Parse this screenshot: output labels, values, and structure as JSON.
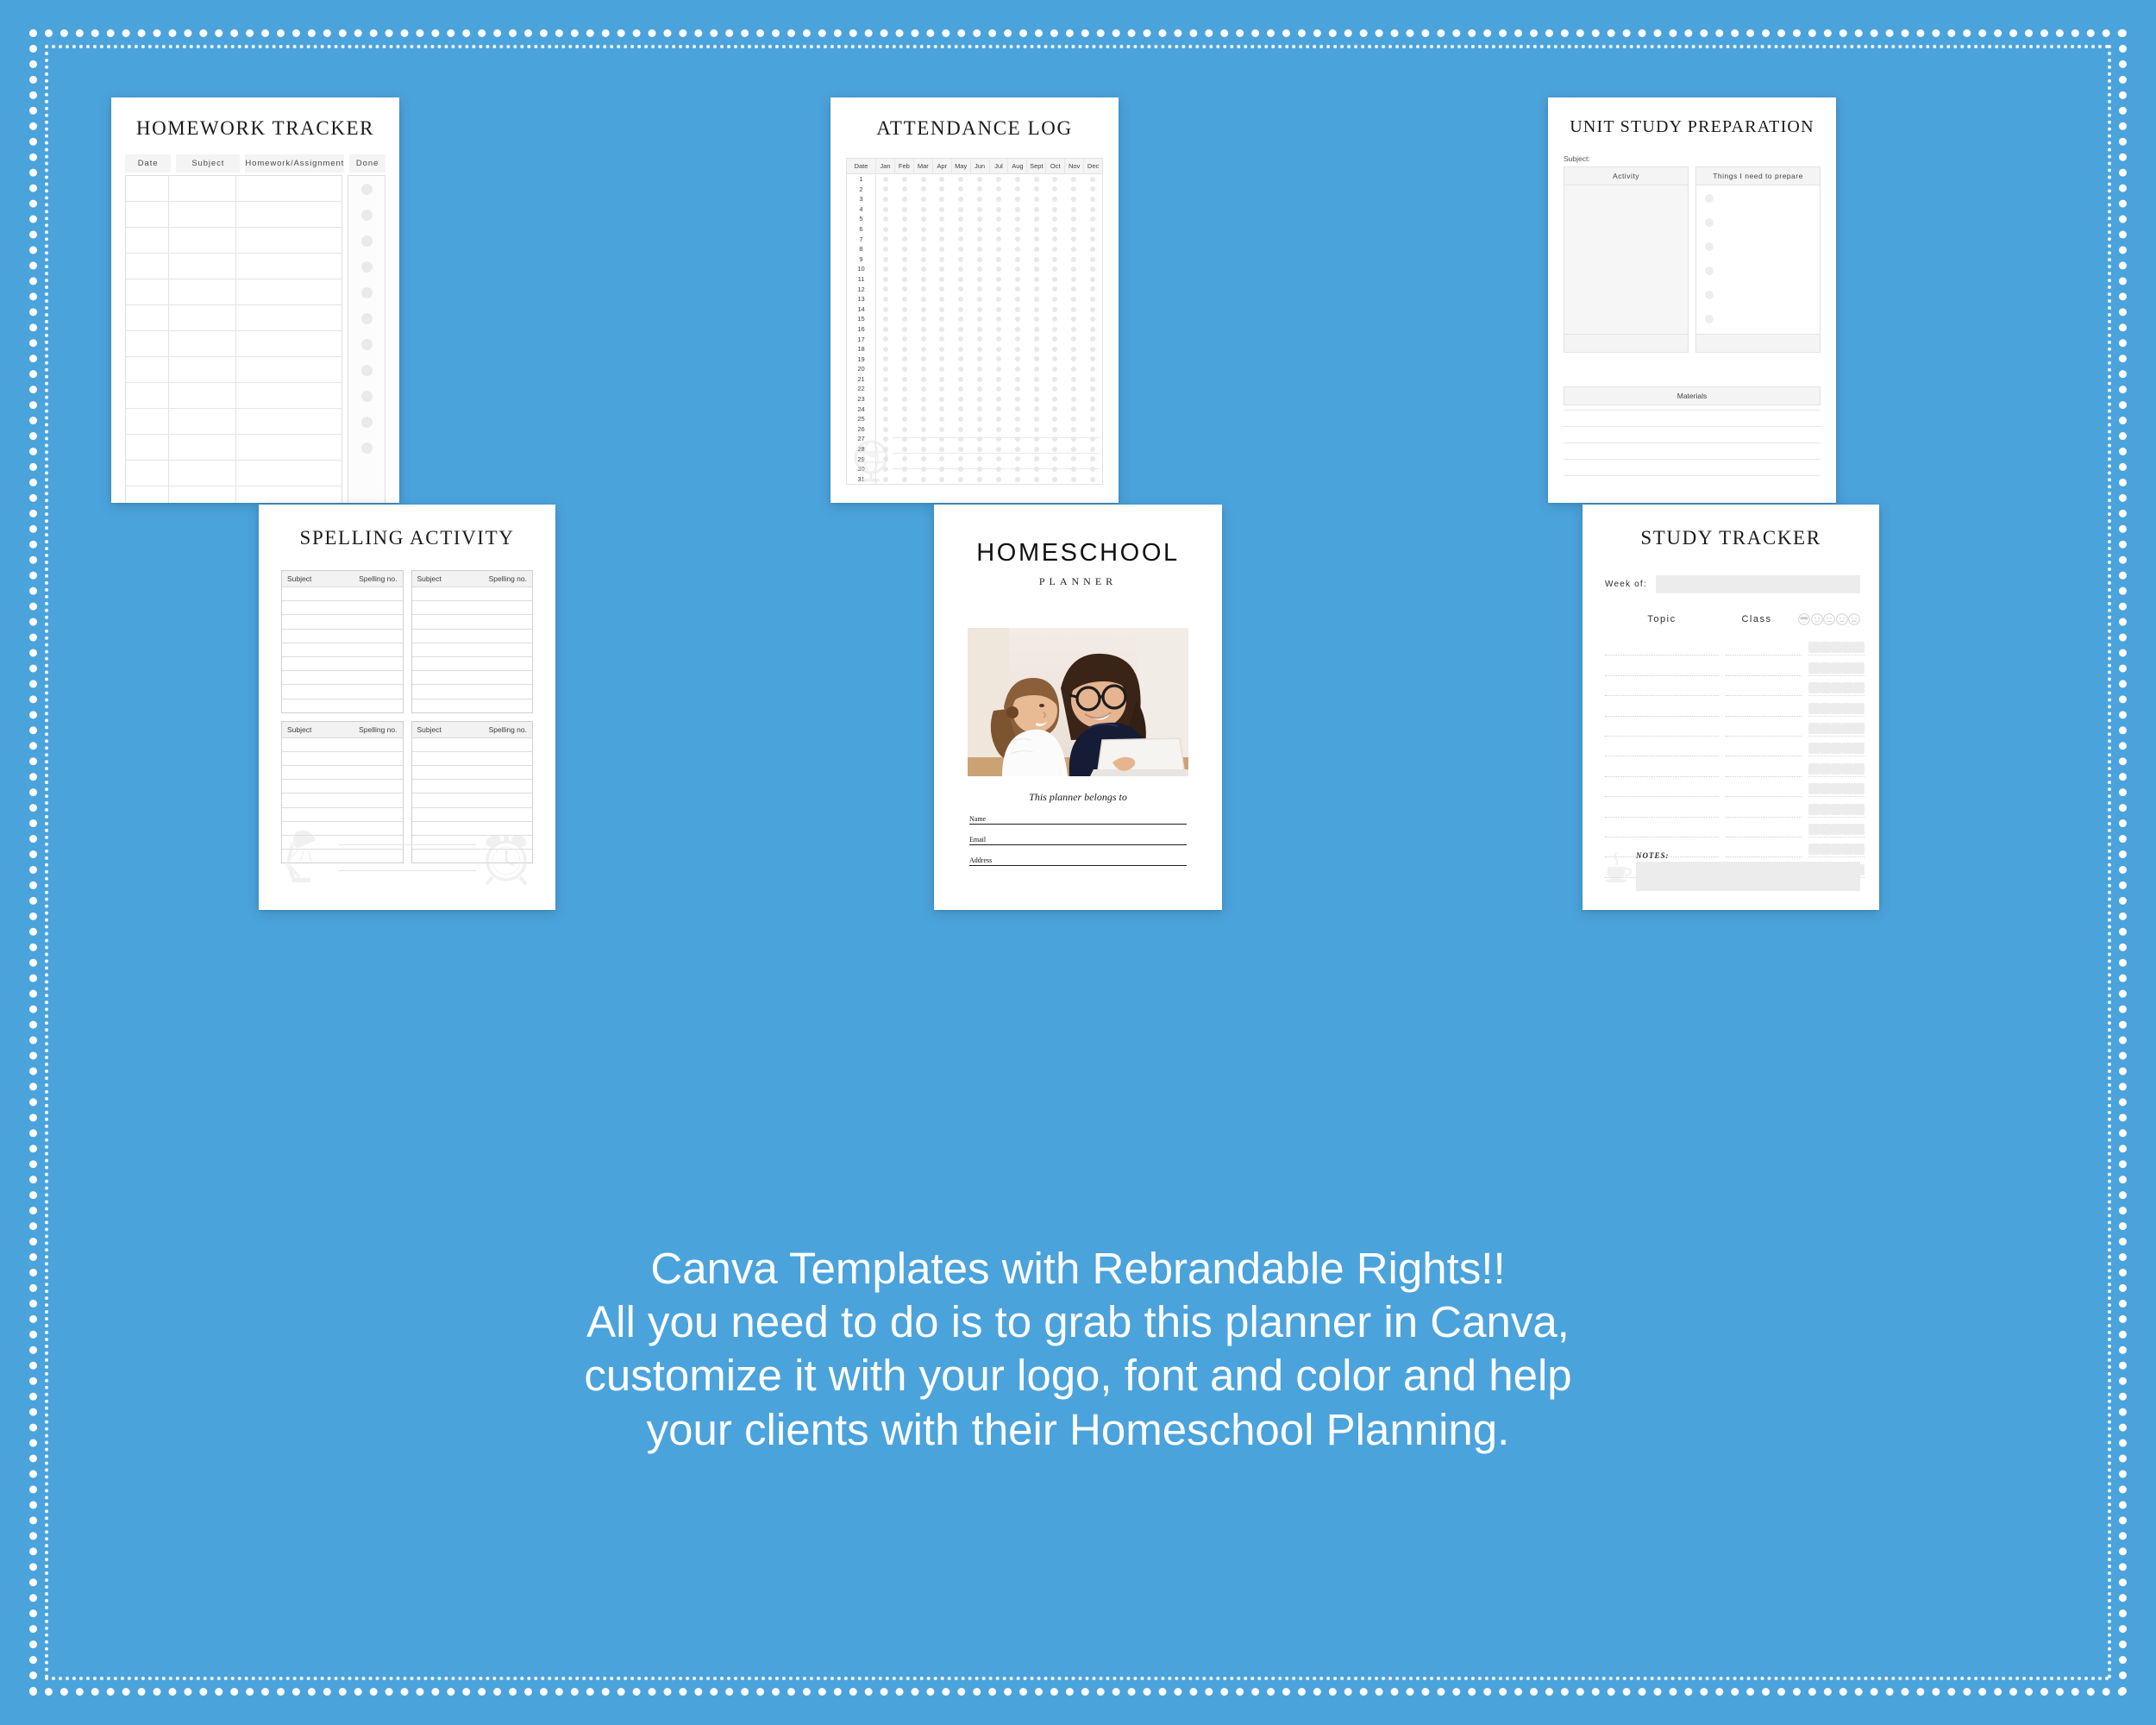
{
  "theme": {
    "background": "#4BA3DC",
    "card_bg": "#ffffff",
    "border_color": "#ffffff",
    "muted": "#ececec"
  },
  "promo": {
    "lines": [
      "Canva Templates with Rebrandable Rights!!",
      "All you need to do is to grab this planner in Canva,",
      "customize it with your logo, font and color and help",
      "your clients with their Homeschool Planning."
    ]
  },
  "cards": {
    "homework_tracker": {
      "title": "HOMEWORK TRACKER",
      "columns": [
        "Date",
        "Subject",
        "Homework/Assignment",
        "Done"
      ],
      "row_count": 13,
      "done_dot_count": 11
    },
    "attendance_log": {
      "title": "ATTENDANCE LOG",
      "date_header": "Date",
      "months": [
        "Jan",
        "Feb",
        "Mar",
        "Apr",
        "May",
        "Jun",
        "Jul",
        "Aug",
        "Sept",
        "Oct",
        "Nov",
        "Dec"
      ],
      "days": [
        1,
        2,
        3,
        4,
        5,
        6,
        7,
        8,
        9,
        10,
        11,
        12,
        13,
        14,
        15,
        16,
        17,
        18,
        19,
        20,
        21,
        22,
        23,
        24,
        25,
        26,
        27,
        28,
        29,
        30,
        31
      ],
      "footer_icon": "globe-icon",
      "footer_line_count": 3
    },
    "unit_study_preparation": {
      "title": "UNIT STUDY PREPARATION",
      "subject_label": "Subject:",
      "column_activity": "Activity",
      "column_prepare": "Things I need to prepare",
      "prepare_bullet_count": 7,
      "materials_label": "Materials",
      "materials_line_count": 5
    },
    "spelling_activity": {
      "title": "SPELLING ACTIVITY",
      "box_subject_label": "Subject",
      "box_number_label": "Spelling no.",
      "box_count": 4,
      "lines_per_box": 9,
      "footer_left_icon": "desk-lamp-icon",
      "footer_right_icon": "alarm-clock-icon",
      "footer_line_count": 2
    },
    "homeschool_planner_cover": {
      "title": "HOMESCHOOL",
      "subtitle": "PLANNER",
      "photo_alt": "mother-and-daughter-with-laptop-photo",
      "belongs_to": "This planner belongs to",
      "fields": [
        "Name",
        "Email",
        "Address"
      ]
    },
    "study_tracker": {
      "title": "STUDY TRACKER",
      "week_label": "Week of:",
      "column_topic": "Topic",
      "column_class": "Class",
      "mood_faces": [
        "cool-face-icon",
        "smiling-face-icon",
        "wink-neutral-face-icon",
        "neutral-face-icon",
        "sad-face-icon"
      ],
      "row_count": 12,
      "checkbox_per_row": 5,
      "notes_label": "NOTES:",
      "notes_icon": "coffee-cup-icon"
    }
  }
}
